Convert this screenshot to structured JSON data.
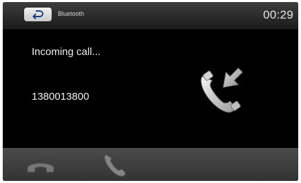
{
  "header": {
    "back_icon": "back-arrow-icon",
    "title": "Bluetooth",
    "clock": "00:29"
  },
  "call": {
    "status": "Incoming call...",
    "number": "1380013800",
    "icon": "incoming-call-icon"
  },
  "actions": {
    "hangup_icon": "hang-up-icon",
    "answer_icon": "answer-call-icon"
  },
  "colors": {
    "screen_background": "#000000",
    "header_background": "#2a2a2a",
    "bottom_bar_background": "#3e3e3e",
    "text": "#f0f0f0",
    "icon_gray": "#8a8a8a"
  }
}
